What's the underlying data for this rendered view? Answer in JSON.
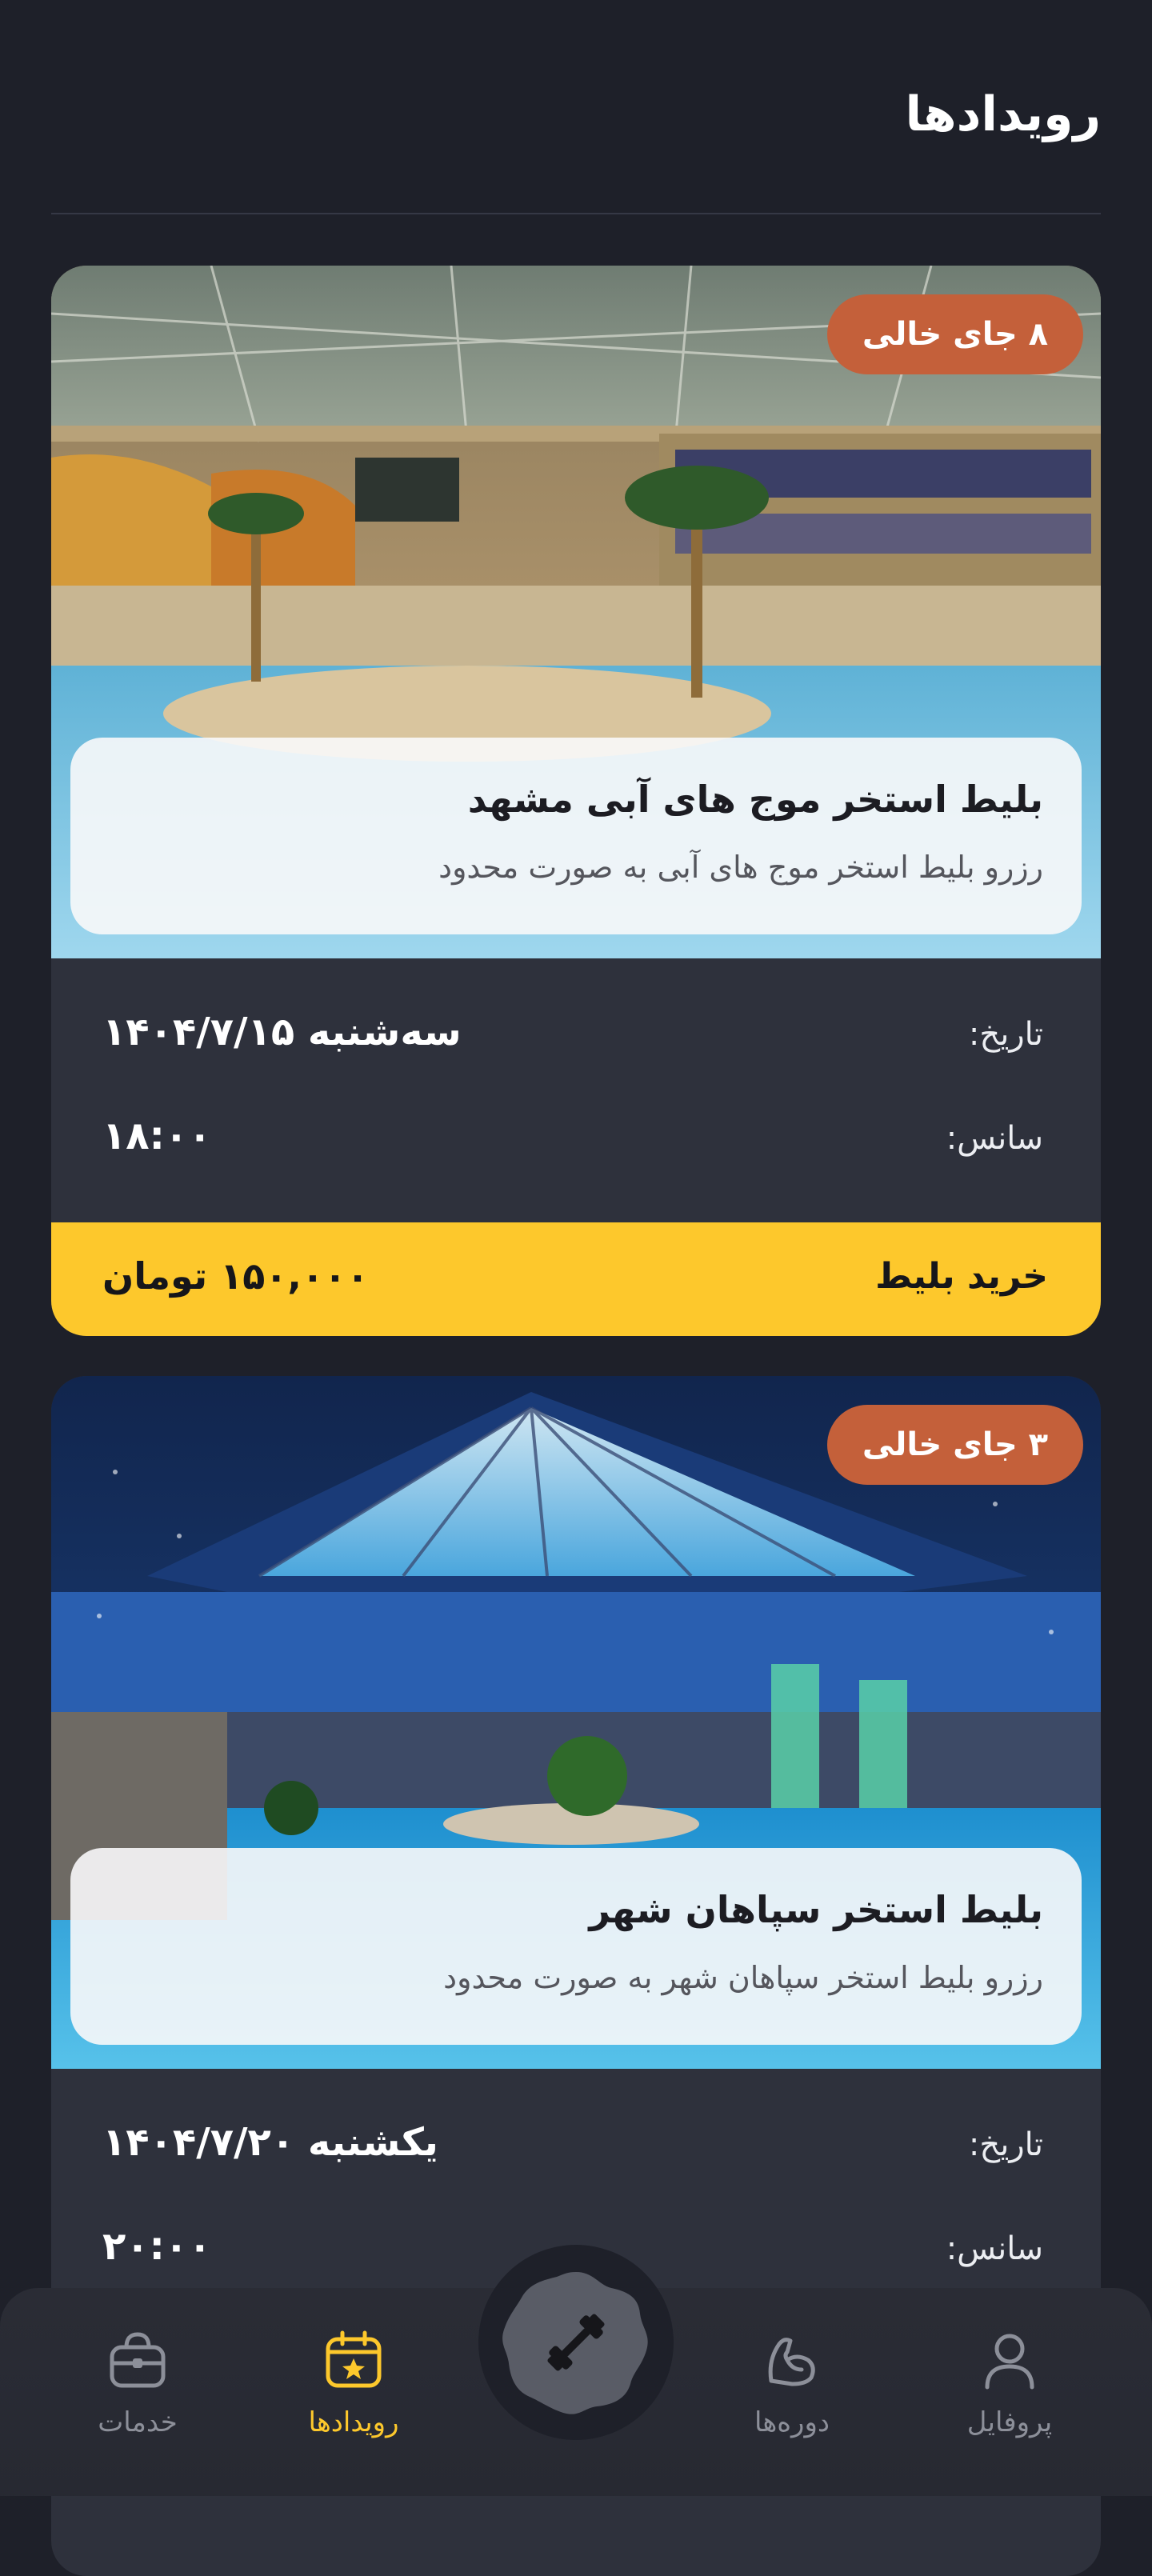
{
  "header": {
    "title": "رویدادها"
  },
  "events": [
    {
      "seats_badge": "۸ جای خالی",
      "title": "بلیط استخر موج های آبی مشهد",
      "subtitle": "رزرو بلیط استخر موج های آبی به صورت محدود",
      "date_label": "تاریخ:",
      "date_value": "سه‌شنبه ۱۴۰۴/۷/۱۵",
      "session_label": "سانس:",
      "session_value": "۱۸:۰۰",
      "buy_label": "خرید بلیط",
      "price": "۱۵۰,۰۰۰ تومان"
    },
    {
      "seats_badge": "۳ جای خالی",
      "title": "بلیط استخر سپاهان شهر",
      "subtitle": "رزرو بلیط استخر سپاهان شهر به صورت محدود",
      "date_label": "تاریخ:",
      "date_value": "یکشنبه ۱۴۰۴/۷/۲۰",
      "session_label": "سانس:",
      "session_value": "۲۰:۰۰"
    }
  ],
  "nav": {
    "items": [
      {
        "label": "پروفایل",
        "icon": "user-icon"
      },
      {
        "label": "دوره‌ها",
        "icon": "muscle-arm-icon"
      },
      {
        "label": "رویدادها",
        "icon": "calendar-star-icon",
        "active": true
      },
      {
        "label": "خدمات",
        "icon": "bag-icon"
      }
    ],
    "center_icon": "dumbbell-icon"
  },
  "colors": {
    "background": "#1e2029",
    "card": "#2e313c",
    "accent": "#fdc82c",
    "badge": "#c4603a"
  }
}
